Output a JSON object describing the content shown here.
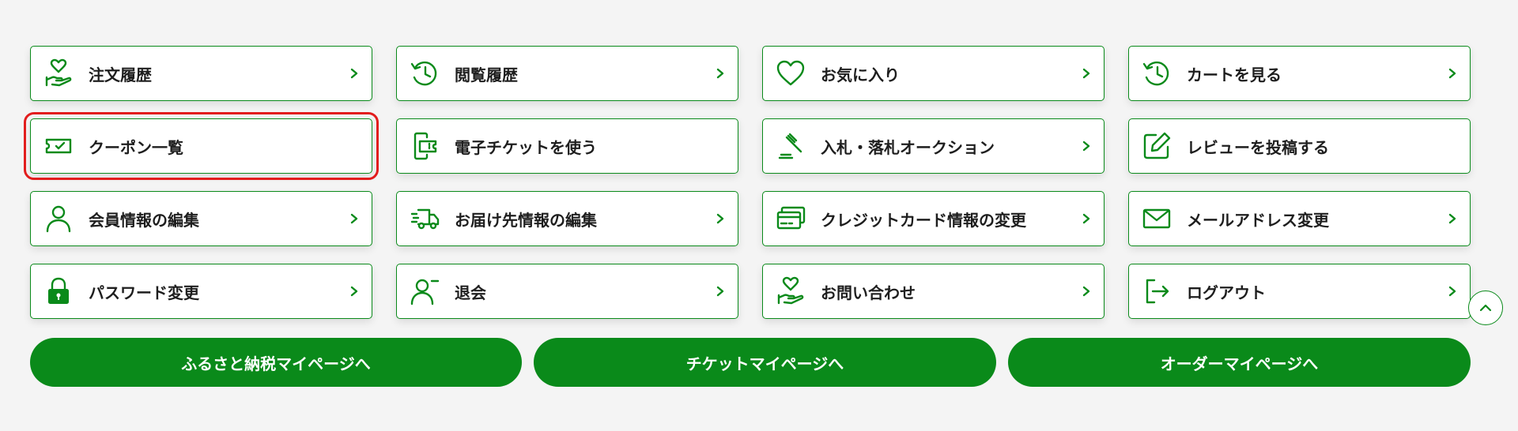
{
  "colors": {
    "accent": "#0a8a1a",
    "highlight": "#e21d1d",
    "background": "#f4f4f4"
  },
  "menu": [
    {
      "label": "注文履歴",
      "icon": "heart-hand-icon",
      "chevron": true
    },
    {
      "label": "閲覧履歴",
      "icon": "history-clock-icon",
      "chevron": true
    },
    {
      "label": "お気に入り",
      "icon": "heart-icon",
      "chevron": true
    },
    {
      "label": "カートを見る",
      "icon": "history-clock-icon",
      "chevron": true
    },
    {
      "label": "クーポン一覧",
      "icon": "coupon-icon",
      "chevron": false,
      "highlighted": true
    },
    {
      "label": "電子チケットを使う",
      "icon": "e-ticket-icon",
      "chevron": false
    },
    {
      "label": "入札・落札オークション",
      "icon": "auction-gavel-icon",
      "chevron": true
    },
    {
      "label": "レビューを投稿する",
      "icon": "edit-review-icon",
      "chevron": false
    },
    {
      "label": "会員情報の編集",
      "icon": "user-icon",
      "chevron": true
    },
    {
      "label": "お届け先情報の編集",
      "icon": "delivery-truck-icon",
      "chevron": true
    },
    {
      "label": "クレジットカード情報の変更",
      "icon": "credit-card-icon",
      "chevron": true
    },
    {
      "label": "メールアドレス変更",
      "icon": "mail-icon",
      "chevron": true
    },
    {
      "label": "パスワード変更",
      "icon": "lock-icon",
      "chevron": true
    },
    {
      "label": "退会",
      "icon": "user-minus-icon",
      "chevron": true
    },
    {
      "label": "お問い合わせ",
      "icon": "heart-hand-icon",
      "chevron": true
    },
    {
      "label": "ログアウト",
      "icon": "logout-icon",
      "chevron": true
    }
  ],
  "buttons": {
    "furusato": "ふるさと納税マイページへ",
    "ticket": "チケットマイページへ",
    "order": "オーダーマイページへ"
  },
  "scroll_top": {
    "icon": "chevron-up-icon"
  }
}
